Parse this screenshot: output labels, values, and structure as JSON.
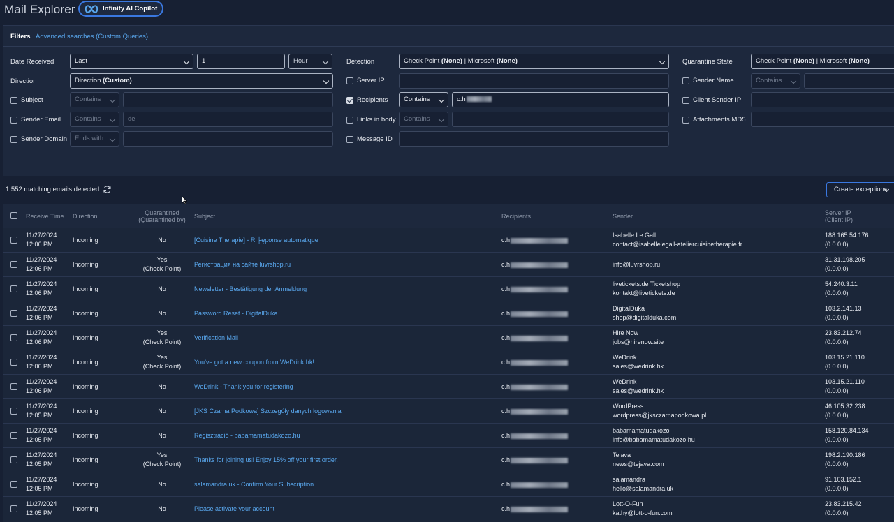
{
  "app": {
    "title": "Mail Explorer",
    "copilot_label": "Infinity AI Copilot"
  },
  "filters": {
    "title": "Filters",
    "advanced_link": "Advanced searches (Custom Queries)",
    "date_received": {
      "label": "Date Received",
      "mode": "Last",
      "value": "1",
      "unit": "Hour"
    },
    "direction": {
      "label": "Direction",
      "value_prefix": "Direction",
      "value_bold": "(Custom)"
    },
    "subject": {
      "label": "Subject",
      "op": "Contains",
      "value": ""
    },
    "sender_email": {
      "label": "Sender Email",
      "op": "Contains",
      "value": "de"
    },
    "sender_domain": {
      "label": "Sender Domain",
      "op": "Ends with",
      "value": ""
    },
    "detection": {
      "label": "Detection",
      "v1": "Check Point",
      "v1b": "(None)",
      "sep": "|",
      "v2": "Microsoft",
      "v2b": "(None)"
    },
    "server_ip": {
      "label": "Server IP",
      "value": ""
    },
    "recipients": {
      "label": "Recipients",
      "op": "Contains",
      "value": "c.h"
    },
    "links_in_body": {
      "label": "Links in body",
      "op": "Contains",
      "value": ""
    },
    "message_id": {
      "label": "Message ID",
      "value": ""
    },
    "quarantine_state": {
      "label": "Quarantine State",
      "v1": "Check Point",
      "v1b": "(None)",
      "sep": "|",
      "v2": "Microsoft",
      "v2b": "(None)"
    },
    "sender_name": {
      "label": "Sender Name",
      "op": "Contains",
      "value": ""
    },
    "client_sender_ip": {
      "label": "Client Sender IP",
      "value": ""
    },
    "attachments_md5": {
      "label": "Attachments MD5",
      "value": ""
    }
  },
  "results": {
    "count_text": "1.552 matching emails detected",
    "create_button": "Create exceptions"
  },
  "table": {
    "headers": {
      "receive_time": "Receive Time",
      "direction": "Direction",
      "quarantined_1": "Quarantined",
      "quarantined_2": "(Quarantined by)",
      "subject": "Subject",
      "recipients": "Recipients",
      "sender": "Sender",
      "server_ip_1": "Server IP",
      "server_ip_2": "(Client IP)"
    },
    "rows": [
      {
        "date": "11/27/2024",
        "time": "12:06 PM",
        "direction": "Incoming",
        "q1": "No",
        "q2": "",
        "subject": "[Cuisine Therapie] - R ├ęponse automatique",
        "recipient": "c.h",
        "sender_name": "Isabelle Le Gall",
        "sender_email": "contact@isabellelegall-ateliercuisinetherapie.fr",
        "server_ip": "188.165.54.176",
        "client_ip": "(0.0.0.0)"
      },
      {
        "date": "11/27/2024",
        "time": "12:06 PM",
        "direction": "Incoming",
        "q1": "Yes",
        "q2": "(Check Point)",
        "subject": "Регистрация на сайте luvrshop.ru",
        "recipient": "c.h",
        "sender_name": "",
        "sender_email": "info@luvrshop.ru",
        "server_ip": "31.31.198.205",
        "client_ip": "(0.0.0.0)"
      },
      {
        "date": "11/27/2024",
        "time": "12:06 PM",
        "direction": "Incoming",
        "q1": "No",
        "q2": "",
        "subject": "Newsletter - Bestätigung der Anmeldung",
        "recipient": "c.h",
        "sender_name": "livetickets.de Ticketshop",
        "sender_email": "kontakt@livetickets.de",
        "server_ip": "54.240.3.11",
        "client_ip": "(0.0.0.0)"
      },
      {
        "date": "11/27/2024",
        "time": "12:06 PM",
        "direction": "Incoming",
        "q1": "No",
        "q2": "",
        "subject": "Password Reset - DigitalDuka",
        "recipient": "c.h",
        "sender_name": "DigitalDuka",
        "sender_email": "shop@digitalduka.com",
        "server_ip": "103.2.141.13",
        "client_ip": "(0.0.0.0)"
      },
      {
        "date": "11/27/2024",
        "time": "12:06 PM",
        "direction": "Incoming",
        "q1": "Yes",
        "q2": "(Check Point)",
        "subject": "Verification Mail",
        "recipient": "c.h",
        "sender_name": "Hire Now",
        "sender_email": "jobs@hirenow.site",
        "server_ip": "23.83.212.74",
        "client_ip": "(0.0.0.0)"
      },
      {
        "date": "11/27/2024",
        "time": "12:06 PM",
        "direction": "Incoming",
        "q1": "Yes",
        "q2": "(Check Point)",
        "subject": "You've got a new coupon from WeDrink.hk!",
        "recipient": "c.h",
        "sender_name": "WeDrink",
        "sender_email": "sales@wedrink.hk",
        "server_ip": "103.15.21.110",
        "client_ip": "(0.0.0.0)"
      },
      {
        "date": "11/27/2024",
        "time": "12:06 PM",
        "direction": "Incoming",
        "q1": "No",
        "q2": "",
        "subject": "WeDrink - Thank you for registering",
        "recipient": "c.h",
        "sender_name": "WeDrink",
        "sender_email": "sales@wedrink.hk",
        "server_ip": "103.15.21.110",
        "client_ip": "(0.0.0.0)"
      },
      {
        "date": "11/27/2024",
        "time": "12:05 PM",
        "direction": "Incoming",
        "q1": "No",
        "q2": "",
        "subject": "[JKS Czarna Podkowa] Szczegóły danych logowania",
        "recipient": "c.h",
        "sender_name": "WordPress",
        "sender_email": "wordpress@jksczarnapodkowa.pl",
        "server_ip": "46.105.32.238",
        "client_ip": "(0.0.0.0)"
      },
      {
        "date": "11/27/2024",
        "time": "12:05 PM",
        "direction": "Incoming",
        "q1": "No",
        "q2": "",
        "subject": "Regisztráció - babamamatudakozo.hu",
        "recipient": "c.h",
        "sender_name": "babamamatudakozo",
        "sender_email": "info@babamamatudakozo.hu",
        "server_ip": "158.120.84.134",
        "client_ip": "(0.0.0.0)"
      },
      {
        "date": "11/27/2024",
        "time": "12:05 PM",
        "direction": "Incoming",
        "q1": "Yes",
        "q2": "(Check Point)",
        "subject": "Thanks for joining us! Enjoy 15% off your first order.",
        "recipient": "c.h",
        "sender_name": "Tejava",
        "sender_email": "news@tejava.com",
        "server_ip": "198.2.190.186",
        "client_ip": "(0.0.0.0)"
      },
      {
        "date": "11/27/2024",
        "time": "12:05 PM",
        "direction": "Incoming",
        "q1": "No",
        "q2": "",
        "subject": "salamandra.uk - Confirm Your Subscription",
        "recipient": "c.h",
        "sender_name": "salamandra",
        "sender_email": "hello@salamandra.uk",
        "server_ip": "91.103.152.1",
        "client_ip": "(0.0.0.0)"
      },
      {
        "date": "11/27/2024",
        "time": "12:05 PM",
        "direction": "Incoming",
        "q1": "No",
        "q2": "",
        "subject": "Please activate your account",
        "recipient": "c.h",
        "sender_name": "Lott-O-Fun",
        "sender_email": "kathy@lott-o-fun.com",
        "server_ip": "23.83.215.42",
        "client_ip": "(0.0.0.0)"
      }
    ]
  }
}
